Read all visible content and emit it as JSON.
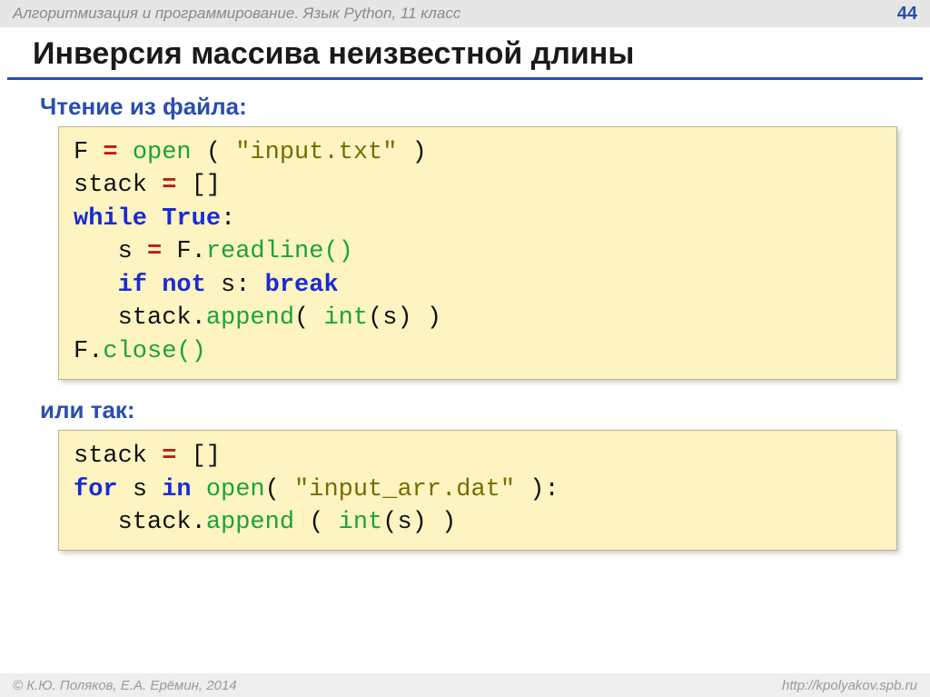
{
  "header": {
    "breadcrumb": "Алгоритмизация и программирование. Язык Python, 11 класс",
    "page": "44"
  },
  "title": "Инверсия массива неизвестной длины",
  "section1": "Чтение из файла:",
  "section2": "или так:",
  "code1": {
    "l1_a": "F",
    "l1_eq": "=",
    "l1_open": "open",
    "l1_b": "(",
    "l1_str": "\"input.txt\"",
    "l1_c": ")",
    "l2_a": "stack",
    "l2_eq": "=",
    "l2_b": "[]",
    "l3_while": "while",
    "l3_true": "True",
    "l3_colon": ":",
    "l4_pad": "   ",
    "l4_a": "s",
    "l4_eq": "=",
    "l4_b": "F.",
    "l4_read": "readline()",
    "l5_pad": "   ",
    "l5_if": "if",
    "l5_not": "not",
    "l5_s": "s:",
    "l5_break": "break",
    "l6_pad": "   ",
    "l6_a": "stack.",
    "l6_app": "append",
    "l6_b": "( ",
    "l6_int": "int",
    "l6_c": "(s) )",
    "l7_a": "F.",
    "l7_close": "close()"
  },
  "code2": {
    "l1_a": "stack",
    "l1_eq": "=",
    "l1_b": "[]",
    "l2_for": "for",
    "l2_a": "s",
    "l2_in": "in",
    "l2_sp": " ",
    "l2_open": "open",
    "l2_b": "( ",
    "l2_str": "\"input_arr.dat\"",
    "l2_c": " ):",
    "l3_pad": "   ",
    "l3_a": "stack.",
    "l3_app": "append",
    "l3_sp": " ",
    "l3_b": "( ",
    "l3_int": "int",
    "l3_c": "(s) )"
  },
  "footer": {
    "left": "© К.Ю. Поляков, Е.А. Ерёмин, 2014",
    "right": "http://kpolyakov.spb.ru"
  }
}
